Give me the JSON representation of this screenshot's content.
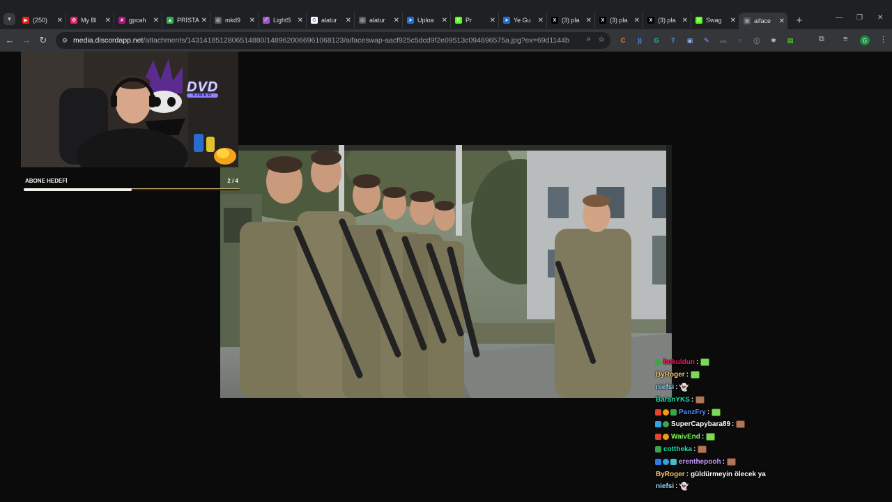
{
  "browser": {
    "tabs": [
      {
        "label": "(250)",
        "fav_color": "#e62117",
        "fav_glyph": "▶",
        "icon_name": "youtube-icon"
      },
      {
        "label": "My Bl",
        "fav_color": "#e0245e",
        "fav_glyph": "✿",
        "icon_name": "pinwheel-icon"
      },
      {
        "label": "gpcah",
        "fav_color": "#b0127e",
        "fav_glyph": "#",
        "icon_name": "hashtag-icon"
      },
      {
        "label": "PRİSTA",
        "fav_color": "#36a852",
        "fav_glyph": "▲",
        "icon_name": "triangle-icon"
      },
      {
        "label": "mkd9",
        "fav_color": "#555a60",
        "fav_glyph": "◎",
        "icon_name": "globe-icon"
      },
      {
        "label": "LightS",
        "fav_color": "#9b59d0",
        "fav_glyph": "⟋",
        "icon_name": "feather-icon"
      },
      {
        "label": "alatur",
        "fav_color": "#ffffff",
        "fav_glyph": "G",
        "icon_name": "google-icon"
      },
      {
        "label": "alatur",
        "fav_color": "#555a60",
        "fav_glyph": "◎",
        "icon_name": "globe-icon"
      },
      {
        "label": "Uploa",
        "fav_color": "#1e6fd9",
        "fav_glyph": "➤",
        "icon_name": "upload-arrow-icon"
      },
      {
        "label": "Pr",
        "fav_color": "#53fc18",
        "fav_glyph": "K",
        "icon_name": "kick-icon"
      },
      {
        "label": "Ye Gu",
        "fav_color": "#1e6fd9",
        "fav_glyph": "➤",
        "icon_name": "upload-arrow-icon"
      },
      {
        "label": "(3) pla",
        "fav_color": "#000000",
        "fav_glyph": "X",
        "icon_name": "x-icon"
      },
      {
        "label": "(3) pla",
        "fav_color": "#000000",
        "fav_glyph": "X",
        "icon_name": "x-icon"
      },
      {
        "label": "(3) pla",
        "fav_color": "#000000",
        "fav_glyph": "X",
        "icon_name": "x-icon"
      },
      {
        "label": "Swag",
        "fav_color": "#53fc18",
        "fav_glyph": "K",
        "icon_name": "kick-icon"
      },
      {
        "label": "aiface",
        "fav_color": "#555a60",
        "fav_glyph": "◎",
        "icon_name": "globe-icon",
        "active": true
      }
    ],
    "close_glyph": "✕",
    "new_tab_glyph": "+",
    "url_host": "media.discordapp.net",
    "url_path": "/attachments/1431418512806514880/1489620066961068123/aifaceswap-aacf925c5dcd9f2e09513c094696575a.jpg?ex=69d1144b&is=69cfc2cb&hm=f...",
    "profile_initial": "G",
    "extensions": [
      {
        "name": "extension-orange-icon",
        "glyph": "C",
        "color": "#f08a24"
      },
      {
        "name": "extension-wave-icon",
        "glyph": "))",
        "color": "#4c8dff"
      },
      {
        "name": "extension-grammarly-icon",
        "glyph": "G",
        "color": "#15c39a"
      },
      {
        "name": "extension-translate-icon",
        "glyph": "T",
        "color": "#4c8dff"
      },
      {
        "name": "extension-badge-icon",
        "glyph": "▣",
        "color": "#8ab4f8"
      },
      {
        "name": "extension-pen-icon",
        "glyph": "✎",
        "color": "#b388ff"
      },
      {
        "name": "extension-dark-icon",
        "glyph": "▬",
        "color": "#5a5a5a"
      },
      {
        "name": "extension-blue-icon",
        "glyph": "≈",
        "color": "#2c5fb3"
      },
      {
        "name": "extension-info-icon",
        "glyph": "ⓘ",
        "color": "#9aa0a6"
      },
      {
        "name": "extension-bug-icon",
        "glyph": "✱",
        "color": "#bdbdbd"
      },
      {
        "name": "extension-green-icon",
        "glyph": "▤",
        "color": "#53fc18"
      }
    ]
  },
  "overlay": {
    "goal_title": "ABONE HEDEFİ",
    "goal_count": "2 / 4",
    "goal_progress": 0.5,
    "dvd_text": "DVD",
    "dvd_sub": "VIDEO"
  },
  "chat": [
    {
      "badges": [
        "#3fa34d"
      ],
      "user": "bokuldun",
      "color": "#e0245e",
      "emote": "green"
    },
    {
      "badges": [],
      "user": "ByRoger",
      "color": "#f7c873",
      "emote": "green"
    },
    {
      "badges": [],
      "user": "niefsi",
      "color": "#9ad9ff",
      "emote": "ghost"
    },
    {
      "badges": [],
      "user": "BaranYKS",
      "color": "#1ee0a6",
      "emote": "face"
    },
    {
      "badges": [
        "#e5432c",
        "#f39c12",
        "#3fa34d"
      ],
      "user": "PanzFry",
      "color": "#4c8dff",
      "emote": "green"
    },
    {
      "badges": [
        "#2fa3e6",
        "#3fa34d"
      ],
      "user": "SuperCapybara89",
      "color": "#ffffff",
      "emote": "face"
    },
    {
      "badges": [
        "#e5432c",
        "#f39c12"
      ],
      "user": "WaivEnd",
      "color": "#7fff5a",
      "emote": "green"
    },
    {
      "badges": [
        "#3fa34d"
      ],
      "user": "cottheka",
      "color": "#1ee0a6",
      "emote": "face"
    },
    {
      "badges": [
        "#2f7be6",
        "#2fa3e6",
        "#4ab8c9"
      ],
      "user": "erenthepooh",
      "color": "#c79cff",
      "emote": "face"
    },
    {
      "badges": [],
      "user": "ByRoger",
      "color": "#f7c873",
      "text": "güldürmeyin ölecek ya"
    },
    {
      "badges": [],
      "user": "niefsi",
      "color": "#9ad9ff",
      "emote": "ghost"
    }
  ],
  "colors": {
    "tabstrip_bg": "#1f2023",
    "toolbar_bg": "#35363a",
    "page_bg": "#0b0b0c"
  }
}
